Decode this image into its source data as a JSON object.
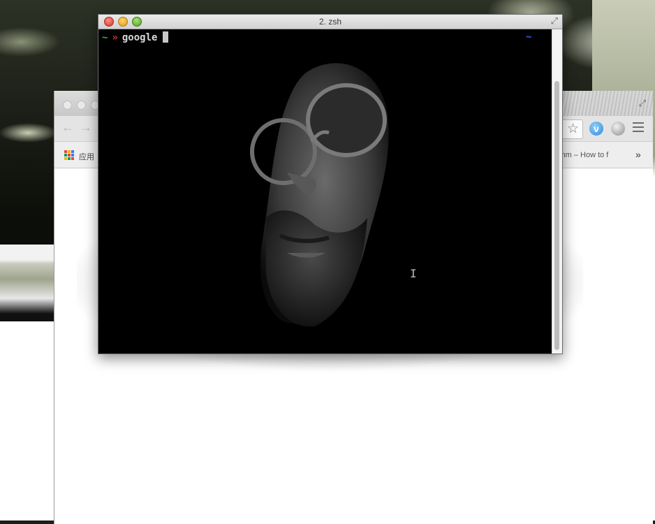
{
  "terminal": {
    "title": "2. zsh",
    "prompt_tilde": "~",
    "prompt_arrow": "»",
    "command": "google",
    "right_prompt": "~"
  },
  "browser": {
    "bookmarks": {
      "apps_label": "应用",
      "item_label": "ithm – How to f",
      "more_label": "»"
    }
  },
  "icons": {
    "close": "close-icon",
    "minimize": "minimize-icon",
    "zoom": "zoom-icon",
    "back": "back-arrow-icon",
    "forward": "forward-arrow-icon",
    "star": "star-icon",
    "menu": "menu-icon"
  },
  "colors": {
    "prompt_tilde": "#2ec22e",
    "prompt_arrow": "#e03030",
    "right_prompt": "#3060ff",
    "terminal_bg": "#000000"
  }
}
